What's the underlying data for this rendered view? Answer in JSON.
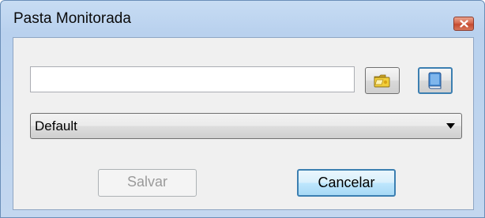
{
  "window": {
    "title": "Pasta Monitorada",
    "close_glyph": "x"
  },
  "path_input": {
    "value": "",
    "placeholder": ""
  },
  "icons": {
    "folder_button": "folder-icon",
    "book_button": "book-icon"
  },
  "profile_select": {
    "value": "Default"
  },
  "buttons": {
    "save_label": "Salvar",
    "cancel_label": "Cancelar"
  },
  "colors": {
    "title_bar": "#b9d1ee",
    "client_bg": "#f0f0f0",
    "close_button": "#c54a2f",
    "focus_border": "#3c7fb1",
    "disabled_text": "#9a9a9a"
  }
}
